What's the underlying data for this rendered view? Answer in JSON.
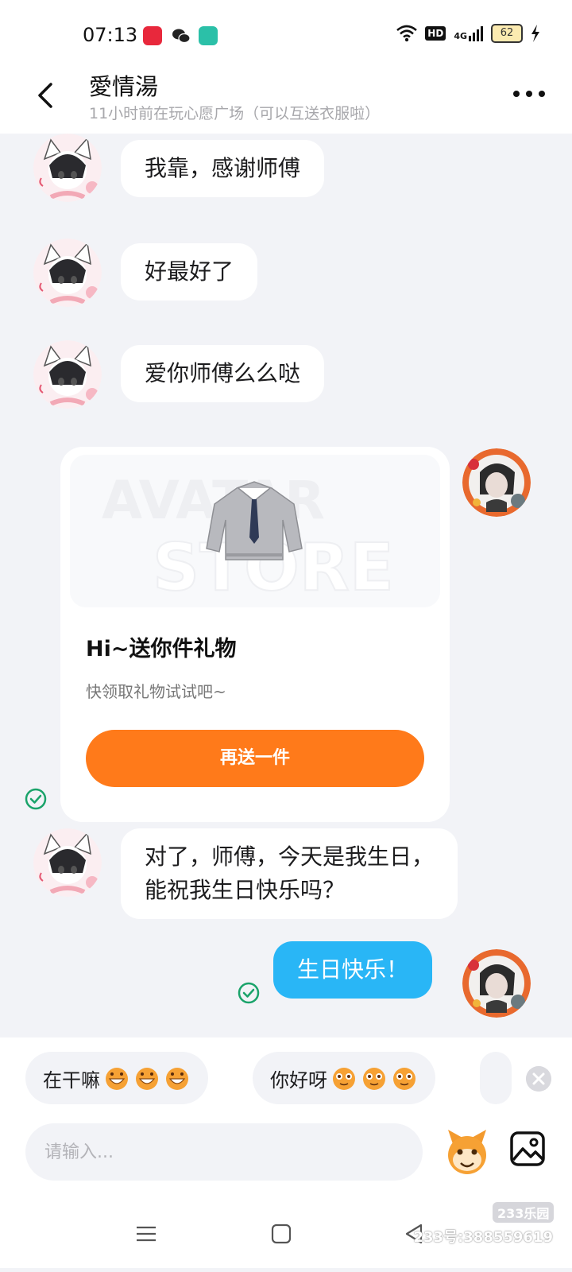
{
  "status_bar": {
    "time": "07:13",
    "network": "4G",
    "hd_label": "HD",
    "battery": "62"
  },
  "header": {
    "title": "愛情湯",
    "subtitle": "11小时前在玩心愿广场（可以互送衣服啦）"
  },
  "messages": [
    {
      "from": "other",
      "text": "我靠，感谢师傅"
    },
    {
      "from": "other",
      "text": "好最好了"
    },
    {
      "from": "other",
      "text": "爱你师傅么么哒"
    },
    {
      "from": "me",
      "type": "gift_card"
    },
    {
      "from": "other",
      "lines": [
        "对了，师傅，今天是我生日，",
        "能祝我生日快乐吗？"
      ]
    },
    {
      "from": "me",
      "text": "生日快乐！",
      "read": true
    }
  ],
  "gift_card": {
    "title": "Hi~送你件礼物",
    "description": "快领取礼物试试吧~",
    "button_label": "再送一件",
    "watermark_top": "AVATAR",
    "watermark_bottom": "STORE",
    "read": true
  },
  "quick_replies": [
    "在干嘛",
    "你好呀"
  ],
  "input": {
    "placeholder": "请输入..."
  },
  "watermark": {
    "logo": "233乐园",
    "text": "233号:388559619"
  },
  "colors": {
    "accent_orange": "#ff7a1a",
    "my_bubble": "#29b6f6",
    "read_check": "#1aa36a",
    "background": "#f2f3f7"
  }
}
